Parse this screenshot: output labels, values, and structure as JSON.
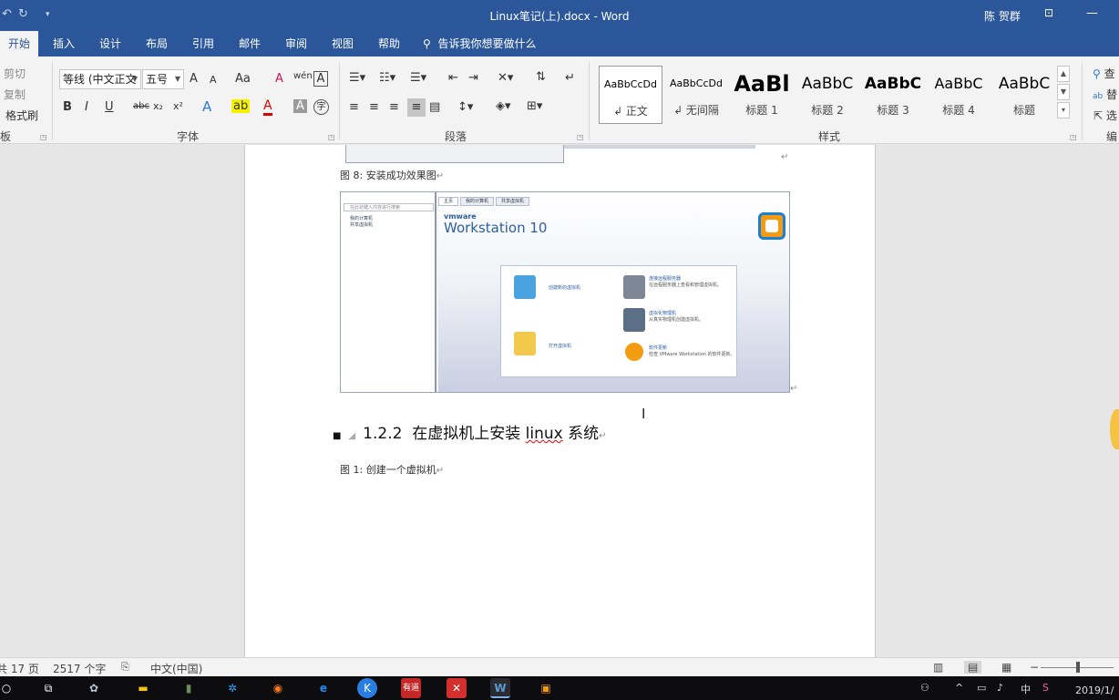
{
  "titlebar": {
    "undo_icon": "undo-icon",
    "redo_icon": "redo-icon",
    "customize_icon": "customize-icon",
    "title": "Linux笔记(上).docx  -  Word",
    "user": "陈 贺群",
    "ribbon_display_icon": "ribbon-display-icon",
    "minimize_glyph": "—"
  },
  "tabs": [
    "开始",
    "插入",
    "设计",
    "布局",
    "引用",
    "邮件",
    "审阅",
    "视图",
    "帮助"
  ],
  "tell_me": "告诉我你想要做什么",
  "clipboard": {
    "cut": "剪切",
    "copy": "复制",
    "format_painter": "格式刷",
    "group_label": "板"
  },
  "font": {
    "font_name": "等线 (中文正文",
    "font_size": "五号",
    "grow": "A",
    "shrink": "A",
    "change_case": "Aa",
    "clear_format": "A",
    "phonetic": "wén",
    "char_border": "A",
    "bold": "B",
    "italic": "I",
    "underline": "U",
    "strike": "abc",
    "sub": "x₂",
    "sup": "x²",
    "text_effect": "A",
    "highlight": "ab",
    "font_color": "A",
    "char_shading": "A",
    "enclose": "字",
    "group_label": "字体"
  },
  "paragraph": {
    "group_label": "段落"
  },
  "styles": {
    "items": [
      {
        "sample": "AaBbCcDd",
        "name": "↲ 正文"
      },
      {
        "sample": "AaBbCcDd",
        "name": "↲ 无间隔"
      },
      {
        "sample": "AaBl",
        "name": "标题 1"
      },
      {
        "sample": "AaBbC",
        "name": "标题 2"
      },
      {
        "sample": "AaBbC",
        "name": "标题 3"
      },
      {
        "sample": "AaBbC",
        "name": "标题 4"
      },
      {
        "sample": "AaBbC",
        "name": "标题"
      }
    ],
    "group_label": "样式"
  },
  "editing": {
    "find": "查",
    "replace": "替",
    "select": "选",
    "group_label": "编"
  },
  "document": {
    "caption_top": "图 8:  安装成功效果图",
    "return_mark": "↵",
    "screenshot": {
      "search_placeholder": "在此处键入内容进行搜索",
      "tree_items": [
        "我的计算机",
        "共享虚拟机"
      ],
      "tabs": [
        "主页",
        "我的计算机",
        "共享虚拟机"
      ],
      "brand": "vmware",
      "product": "Workstation 10",
      "actions": [
        {
          "title": "创建新的虚拟机",
          "desc": ""
        },
        {
          "title": "连接远程服务器",
          "desc": "在远程服务器上查看和管理虚拟机。"
        },
        {
          "title": "虚拟化物理机",
          "desc": "从真实物理机创建虚拟机。"
        },
        {
          "title": "打开虚拟机",
          "desc": ""
        },
        {
          "title": "软件更新",
          "desc": "检查 VMware Workstation 的软件更新。"
        }
      ]
    },
    "heading_number": "1.2.2",
    "heading_text_a": "在虚拟机上安装",
    "heading_linux": "linux",
    "heading_text_b": "系统",
    "caption_bottom": "图 1:  创建一个虚拟机"
  },
  "status": {
    "pages": "共 17 页",
    "words": "2517 个字",
    "language": "中文(中国)"
  },
  "taskbar": {
    "clock": "2019/1/",
    "ime": "中"
  }
}
